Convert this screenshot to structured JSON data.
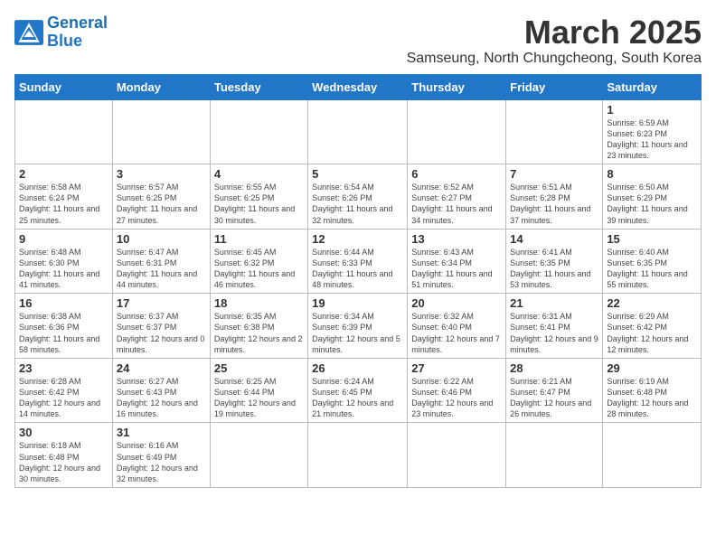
{
  "logo": {
    "text_general": "General",
    "text_blue": "Blue"
  },
  "title": "March 2025",
  "subtitle": "Samseung, North Chungcheong, South Korea",
  "weekdays": [
    "Sunday",
    "Monday",
    "Tuesday",
    "Wednesday",
    "Thursday",
    "Friday",
    "Saturday"
  ],
  "weeks": [
    [
      {
        "day": "",
        "info": ""
      },
      {
        "day": "",
        "info": ""
      },
      {
        "day": "",
        "info": ""
      },
      {
        "day": "",
        "info": ""
      },
      {
        "day": "",
        "info": ""
      },
      {
        "day": "",
        "info": ""
      },
      {
        "day": "1",
        "info": "Sunrise: 6:59 AM\nSunset: 6:23 PM\nDaylight: 11 hours and 23 minutes."
      }
    ],
    [
      {
        "day": "2",
        "info": "Sunrise: 6:58 AM\nSunset: 6:24 PM\nDaylight: 11 hours and 25 minutes."
      },
      {
        "day": "3",
        "info": "Sunrise: 6:57 AM\nSunset: 6:25 PM\nDaylight: 11 hours and 27 minutes."
      },
      {
        "day": "4",
        "info": "Sunrise: 6:55 AM\nSunset: 6:25 PM\nDaylight: 11 hours and 30 minutes."
      },
      {
        "day": "5",
        "info": "Sunrise: 6:54 AM\nSunset: 6:26 PM\nDaylight: 11 hours and 32 minutes."
      },
      {
        "day": "6",
        "info": "Sunrise: 6:52 AM\nSunset: 6:27 PM\nDaylight: 11 hours and 34 minutes."
      },
      {
        "day": "7",
        "info": "Sunrise: 6:51 AM\nSunset: 6:28 PM\nDaylight: 11 hours and 37 minutes."
      },
      {
        "day": "8",
        "info": "Sunrise: 6:50 AM\nSunset: 6:29 PM\nDaylight: 11 hours and 39 minutes."
      }
    ],
    [
      {
        "day": "9",
        "info": "Sunrise: 6:48 AM\nSunset: 6:30 PM\nDaylight: 11 hours and 41 minutes."
      },
      {
        "day": "10",
        "info": "Sunrise: 6:47 AM\nSunset: 6:31 PM\nDaylight: 11 hours and 44 minutes."
      },
      {
        "day": "11",
        "info": "Sunrise: 6:45 AM\nSunset: 6:32 PM\nDaylight: 11 hours and 46 minutes."
      },
      {
        "day": "12",
        "info": "Sunrise: 6:44 AM\nSunset: 6:33 PM\nDaylight: 11 hours and 48 minutes."
      },
      {
        "day": "13",
        "info": "Sunrise: 6:43 AM\nSunset: 6:34 PM\nDaylight: 11 hours and 51 minutes."
      },
      {
        "day": "14",
        "info": "Sunrise: 6:41 AM\nSunset: 6:35 PM\nDaylight: 11 hours and 53 minutes."
      },
      {
        "day": "15",
        "info": "Sunrise: 6:40 AM\nSunset: 6:35 PM\nDaylight: 11 hours and 55 minutes."
      }
    ],
    [
      {
        "day": "16",
        "info": "Sunrise: 6:38 AM\nSunset: 6:36 PM\nDaylight: 11 hours and 58 minutes."
      },
      {
        "day": "17",
        "info": "Sunrise: 6:37 AM\nSunset: 6:37 PM\nDaylight: 12 hours and 0 minutes."
      },
      {
        "day": "18",
        "info": "Sunrise: 6:35 AM\nSunset: 6:38 PM\nDaylight: 12 hours and 2 minutes."
      },
      {
        "day": "19",
        "info": "Sunrise: 6:34 AM\nSunset: 6:39 PM\nDaylight: 12 hours and 5 minutes."
      },
      {
        "day": "20",
        "info": "Sunrise: 6:32 AM\nSunset: 6:40 PM\nDaylight: 12 hours and 7 minutes."
      },
      {
        "day": "21",
        "info": "Sunrise: 6:31 AM\nSunset: 6:41 PM\nDaylight: 12 hours and 9 minutes."
      },
      {
        "day": "22",
        "info": "Sunrise: 6:29 AM\nSunset: 6:42 PM\nDaylight: 12 hours and 12 minutes."
      }
    ],
    [
      {
        "day": "23",
        "info": "Sunrise: 6:28 AM\nSunset: 6:42 PM\nDaylight: 12 hours and 14 minutes."
      },
      {
        "day": "24",
        "info": "Sunrise: 6:27 AM\nSunset: 6:43 PM\nDaylight: 12 hours and 16 minutes."
      },
      {
        "day": "25",
        "info": "Sunrise: 6:25 AM\nSunset: 6:44 PM\nDaylight: 12 hours and 19 minutes."
      },
      {
        "day": "26",
        "info": "Sunrise: 6:24 AM\nSunset: 6:45 PM\nDaylight: 12 hours and 21 minutes."
      },
      {
        "day": "27",
        "info": "Sunrise: 6:22 AM\nSunset: 6:46 PM\nDaylight: 12 hours and 23 minutes."
      },
      {
        "day": "28",
        "info": "Sunrise: 6:21 AM\nSunset: 6:47 PM\nDaylight: 12 hours and 26 minutes."
      },
      {
        "day": "29",
        "info": "Sunrise: 6:19 AM\nSunset: 6:48 PM\nDaylight: 12 hours and 28 minutes."
      }
    ],
    [
      {
        "day": "30",
        "info": "Sunrise: 6:18 AM\nSunset: 6:48 PM\nDaylight: 12 hours and 30 minutes."
      },
      {
        "day": "31",
        "info": "Sunrise: 6:16 AM\nSunset: 6:49 PM\nDaylight: 12 hours and 32 minutes."
      },
      {
        "day": "",
        "info": ""
      },
      {
        "day": "",
        "info": ""
      },
      {
        "day": "",
        "info": ""
      },
      {
        "day": "",
        "info": ""
      },
      {
        "day": "",
        "info": ""
      }
    ]
  ]
}
